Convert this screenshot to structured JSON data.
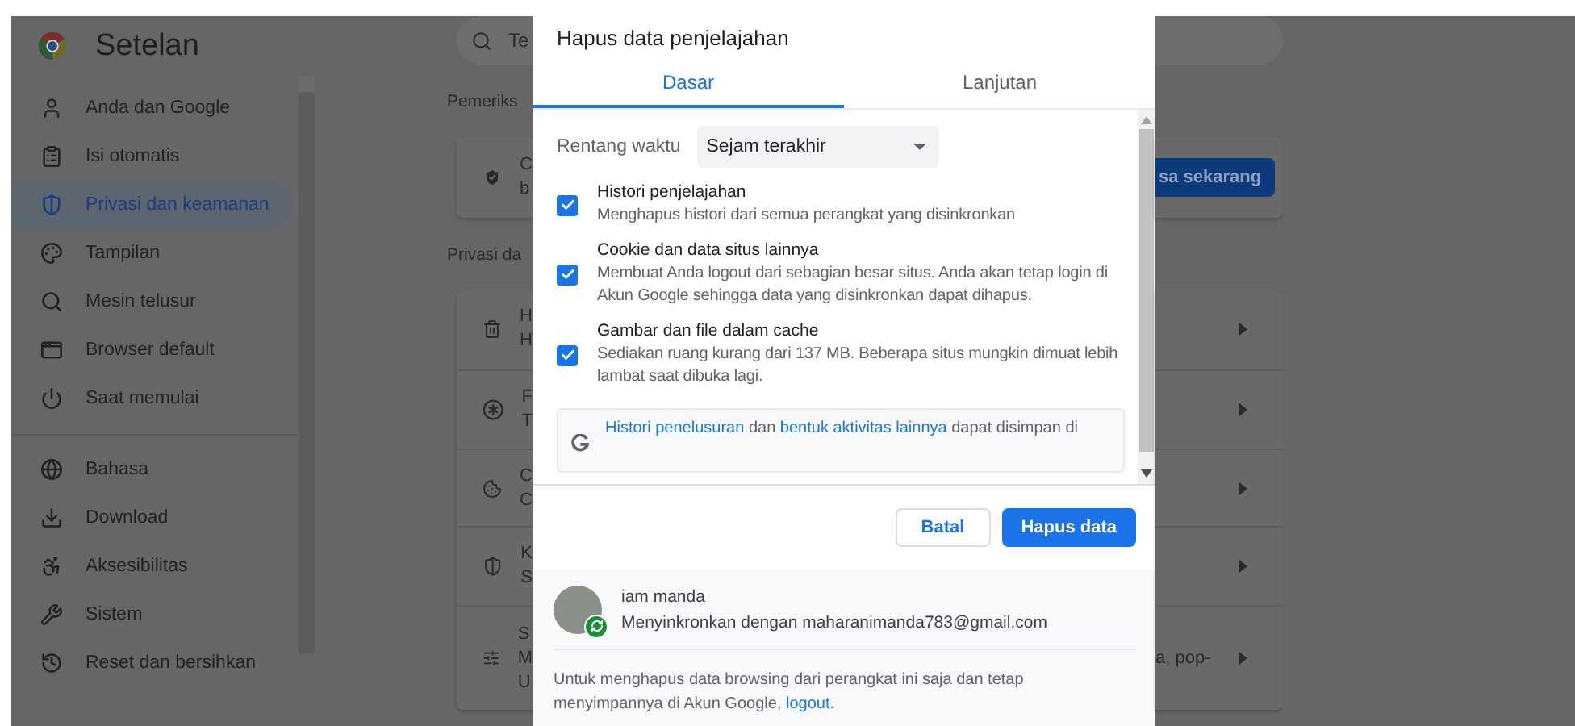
{
  "app": {
    "title": "Setelan"
  },
  "sidebar": {
    "groups": [
      [
        {
          "label": "Anda dan Google",
          "selected": false
        },
        {
          "label": "Isi otomatis",
          "selected": false
        },
        {
          "label": "Privasi dan keamanan",
          "selected": true
        },
        {
          "label": "Tampilan",
          "selected": false
        },
        {
          "label": "Mesin telusur",
          "selected": false
        },
        {
          "label": "Browser default",
          "selected": false
        },
        {
          "label": "Saat memulai",
          "selected": false
        }
      ],
      [
        {
          "label": "Bahasa",
          "selected": false
        },
        {
          "label": "Download",
          "selected": false
        },
        {
          "label": "Aksesibilitas",
          "selected": false
        },
        {
          "label": "Sistem",
          "selected": false
        },
        {
          "label": "Reset dan bersihkan",
          "selected": false
        }
      ]
    ]
  },
  "background": {
    "search": {
      "placeholder": "Te"
    },
    "safety_check": {
      "heading": "Pemeriks",
      "lines": [
        "C",
        "b"
      ],
      "button": "sa sekarang"
    },
    "privacy": {
      "heading": "Privasi da",
      "rows": [
        {
          "lines": [
            "H",
            "H"
          ]
        },
        {
          "lines": [
            "F",
            "T"
          ]
        },
        {
          "lines": [
            "C",
            "C"
          ]
        },
        {
          "lines": [
            "K",
            "S"
          ]
        },
        {
          "lines": [
            "S",
            "M",
            "U"
          ],
          "right_text": "a, pop-"
        }
      ]
    }
  },
  "dialog": {
    "title": "Hapus data penjelajahan",
    "tabs": [
      {
        "label": "Dasar",
        "selected": true
      },
      {
        "label": "Lanjutan",
        "selected": false
      }
    ],
    "time_range": {
      "label": "Rentang waktu",
      "value": "Sejam terakhir"
    },
    "options": [
      {
        "title": "Histori penjelajahan",
        "description": "Menghapus histori dari semua perangkat yang disinkronkan",
        "checked": true
      },
      {
        "title": "Cookie dan data situs lainnya",
        "description": "Membuat Anda logout dari sebagian besar situs. Anda akan tetap login di Akun Google sehingga data yang disinkronkan dapat dihapus.",
        "checked": true
      },
      {
        "title": "Gambar dan file dalam cache",
        "description": "Sediakan ruang kurang dari 137 MB. Beberapa situs mungkin dimuat lebih lambat saat dibuka lagi.",
        "checked": true
      }
    ],
    "notice": [
      {
        "text": "Histori penelusuran",
        "link": true
      },
      {
        "text": " dan ",
        "link": false
      },
      {
        "text": "bentuk aktivitas lainnya",
        "link": true
      },
      {
        "text": " dapat disimpan di",
        "link": false
      }
    ],
    "buttons": [
      {
        "label": "Batal",
        "kind": "secondary"
      },
      {
        "label": "Hapus data",
        "kind": "primary"
      }
    ],
    "account": {
      "name": "iam manda",
      "sync": "Menyinkronkan dengan maharanimanda783@gmail.com"
    },
    "footer_note": {
      "text": "Untuk menghapus data browsing dari perangkat ini saja dan tetap menyimpannya di Akun Google, ",
      "link": "logout",
      "end": "."
    }
  }
}
